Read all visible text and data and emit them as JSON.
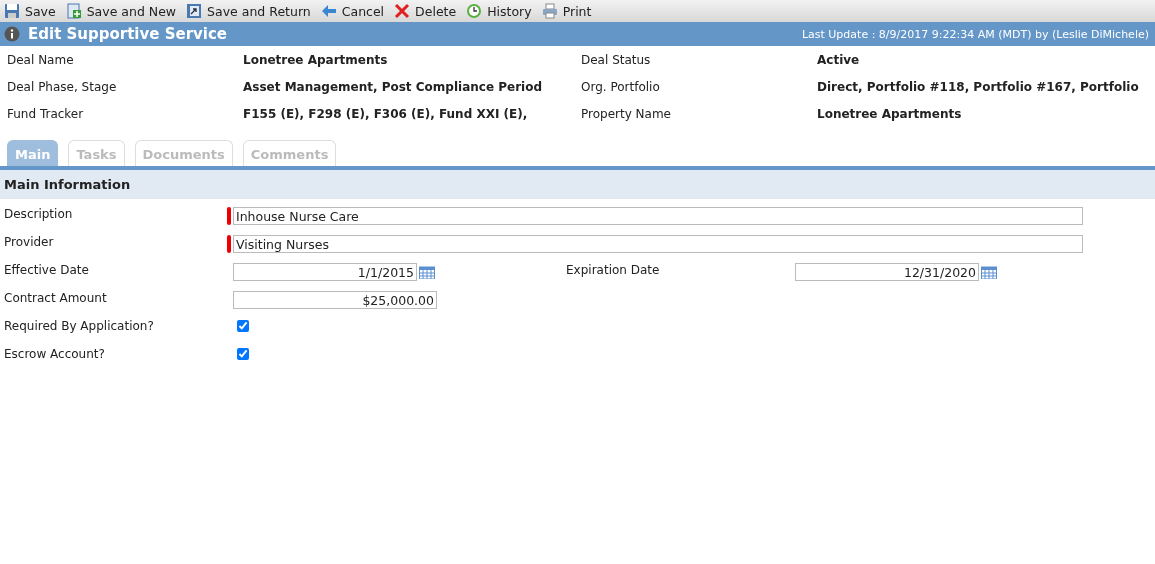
{
  "toolbar": [
    {
      "label": "Save",
      "kind": "save"
    },
    {
      "label": "Save and New",
      "kind": "new"
    },
    {
      "label": "Save and Return",
      "kind": "return"
    },
    {
      "label": "Cancel",
      "kind": "cancel"
    },
    {
      "label": "Delete",
      "kind": "delete"
    },
    {
      "label": "History",
      "kind": "history"
    },
    {
      "label": "Print",
      "kind": "print"
    }
  ],
  "header": {
    "title": "Edit Supportive Service",
    "last_update": "Last Update : 8/9/2017 9:22:34 AM (MDT) by (Leslie DiMichele)"
  },
  "deal_info": [
    {
      "label": "Deal Name",
      "value": "Lonetree Apartments"
    },
    {
      "label": "Deal Status",
      "value": "Active"
    },
    {
      "label": "Deal Phase, Stage",
      "value": "Asset Management, Post Compliance Period"
    },
    {
      "label": "Org. Portfolio",
      "value": "Direct, Portfolio #118, Portfolio #167, Portfolio"
    },
    {
      "label": "Fund Tracker",
      "value": "F155 (E), F298 (E), F306 (E), Fund XXI (E),"
    },
    {
      "label": "Property Name",
      "value": "Lonetree Apartments"
    }
  ],
  "tabs": [
    {
      "label": "Main",
      "selected": true
    },
    {
      "label": "Tasks",
      "selected": false
    },
    {
      "label": "Documents",
      "selected": false
    },
    {
      "label": "Comments",
      "selected": false
    }
  ],
  "section": {
    "title": "Main Information"
  },
  "form_rows": [
    [
      {
        "kind": "text",
        "label": "Description",
        "value": "Inhouse Nurse Care",
        "required": true
      }
    ],
    [
      {
        "kind": "text",
        "label": "Provider",
        "value": "Visiting Nurses",
        "required": true
      }
    ],
    [
      {
        "kind": "date",
        "label": "Effective Date",
        "value": "1/1/2015"
      },
      {
        "kind": "date",
        "label": "Expiration Date",
        "value": "12/31/2020"
      }
    ],
    [
      {
        "kind": "money",
        "label": "Contract Amount",
        "value": "$25,000.00"
      }
    ],
    [
      {
        "kind": "checkbox",
        "label": "Required By Application?",
        "checked": true
      }
    ],
    [
      {
        "kind": "checkbox",
        "label": "Escrow Account?",
        "checked": true
      }
    ]
  ]
}
